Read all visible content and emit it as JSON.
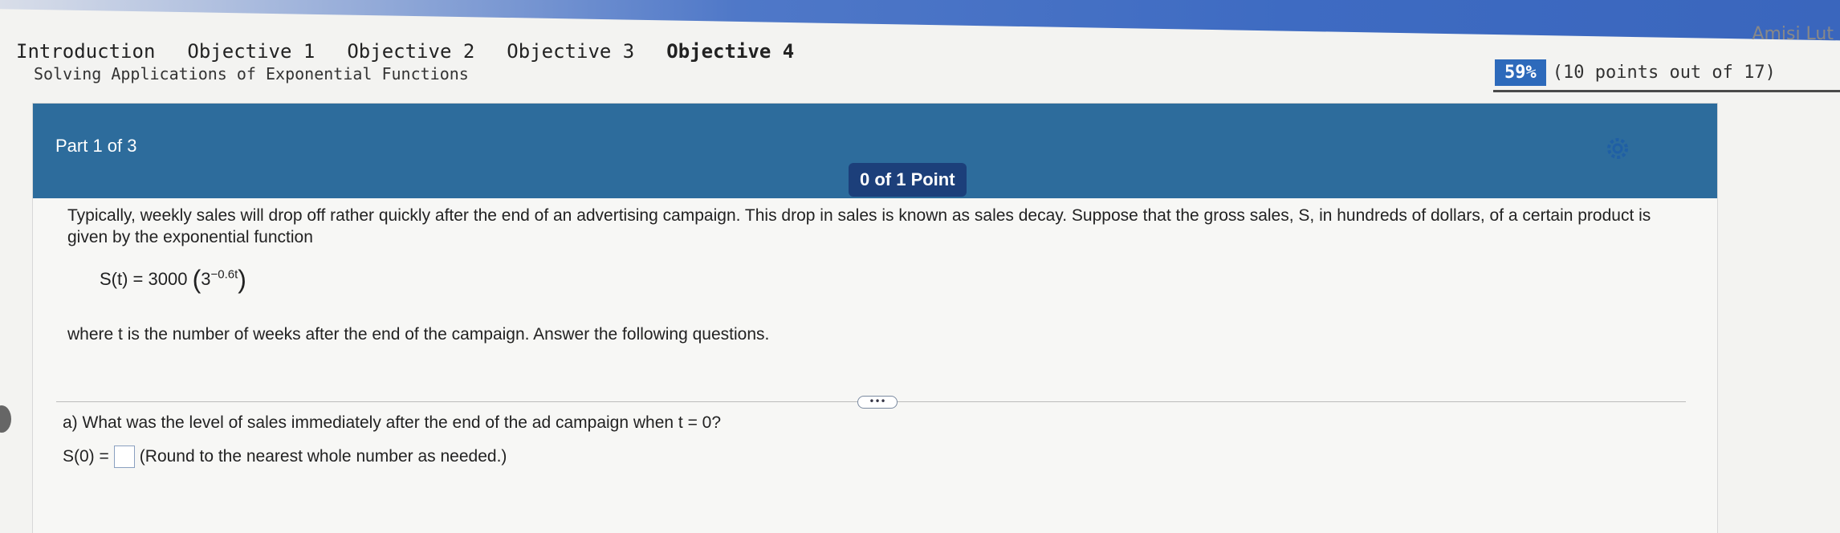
{
  "header": {
    "user_name": "Amisi Lut"
  },
  "tabs": [
    {
      "label": "Introduction"
    },
    {
      "label": "Objective 1"
    },
    {
      "label": "Objective 2"
    },
    {
      "label": "Objective 3"
    },
    {
      "label": "Objective 4",
      "active": true
    }
  ],
  "subtitle": "Solving Applications of Exponential Functions",
  "score": {
    "percent": "59%",
    "detail": "(10 points out of 17)"
  },
  "card": {
    "part_label": "Part 1 of 3",
    "points": "0 of 1 Point",
    "problem_text": "Typically, weekly sales will drop off rather quickly after the end of an advertising campaign. This drop in sales is known as sales decay. Suppose that the gross sales, S, in hundreds of dollars, of a certain product is given by the exponential function",
    "formula_lhs": "S(t) = 3000",
    "formula_base": "3",
    "formula_exp": "−0.6t",
    "where_text": "where t is the number of weeks after the end of the campaign. Answer the following questions.",
    "more_label": "•••",
    "question_text": "a) What was the level of sales immediately after the end of the ad campaign when t = 0?",
    "answer_prefix": "S(0) =",
    "answer_hint": "(Round to the nearest whole number as needed.)"
  },
  "colors": {
    "header_blue": "#2d6c9c",
    "badge_navy": "#1c3f7a",
    "score_blue": "#2d6abb"
  }
}
